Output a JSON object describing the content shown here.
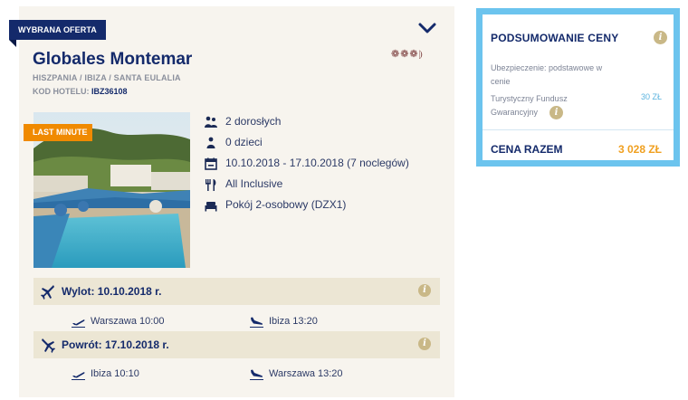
{
  "offer": {
    "ribbon": "WYBRANA OFERTA",
    "badge": "LAST MINUTE",
    "name": "Globales Montemar",
    "region": "HISZPANIA / IBIZA / SANTA EULALIA",
    "code_label": "KOD HOTELU:",
    "code": "IBZ36108",
    "stars": "❁❁❁",
    "half_star": "⦈",
    "details": [
      {
        "icon": "adults-icon",
        "text": "2 dorosłych"
      },
      {
        "icon": "child-icon",
        "text": "0 dzieci"
      },
      {
        "icon": "calendar-icon",
        "text": "10.10.2018 - 17.10.2018 (7 noclegów)"
      },
      {
        "icon": "meal-icon",
        "text": "All Inclusive"
      },
      {
        "icon": "bed-icon",
        "text": "Pokój 2-osobowy (DZX1)"
      }
    ]
  },
  "flights": {
    "outbound": {
      "title": "Wylot: 10.10.2018 r.",
      "depart": "Warszawa 10:00",
      "arrive": "Ibiza 13:20"
    },
    "return": {
      "title": "Powrót: 17.10.2018 r.",
      "depart": "Ibiza 10:10",
      "arrive": "Warszawa 13:20"
    },
    "info_glyph": "i"
  },
  "summary": {
    "title": "PODSUMOWANIE CENY",
    "insurance": "Ubezpieczenie: podstawowe w cenie",
    "fund_label": "Turystyczny Fundusz Gwarancyjny",
    "fund_value": "30 ZŁ",
    "total_label": "CENA RAZEM",
    "total_value": "3 028 ZŁ",
    "info_glyph": "i"
  },
  "colors": {
    "navy": "#142a6b",
    "orange": "#f08a00",
    "summary_border": "#6cc4ee",
    "total_price": "#f0a020"
  }
}
